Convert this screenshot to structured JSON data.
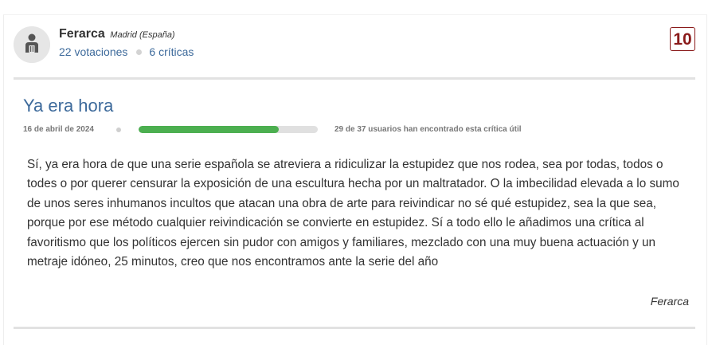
{
  "reviewer": {
    "name": "Ferarca",
    "location": "Madrid (España)",
    "votes_label": "22 votaciones",
    "reviews_label": "6 críticas",
    "avatar_icon": "user-avatar-icon"
  },
  "review": {
    "rating": "10",
    "title": "Ya era hora",
    "date": "16 de abril de 2024",
    "useful_fraction": 0.784,
    "useful_text": "29 de 37 usuarios han encontrado esta crítica útil",
    "body": "Sí, ya era hora de que una serie española se atreviera a ridiculizar la estupidez que nos rodea, sea por todas, todos o todes o por querer censurar la exposición de una escultura hecha por un maltratador. O la imbecilidad elevada a lo sumo de unos seres inhumanos incultos que atacan una obra de arte para reivindicar no sé qué estupidez, sea la que sea, porque por ese método cualquier reivindicación se convierte en estupidez. Sí a todo ello le añadimos una crítica al favoritismo que los políticos ejercen sin pudor con amigos y familiares, mezclado con una muy buena actuación y un metraje idóneo, 25 minutos, creo que nos encontramos ante la serie del año",
    "signature": "Ferarca"
  },
  "colors": {
    "link": "#3d6a9b",
    "rating": "#8a1a1a",
    "progress": "#4caf50",
    "progress_track": "#e0e0e0"
  }
}
